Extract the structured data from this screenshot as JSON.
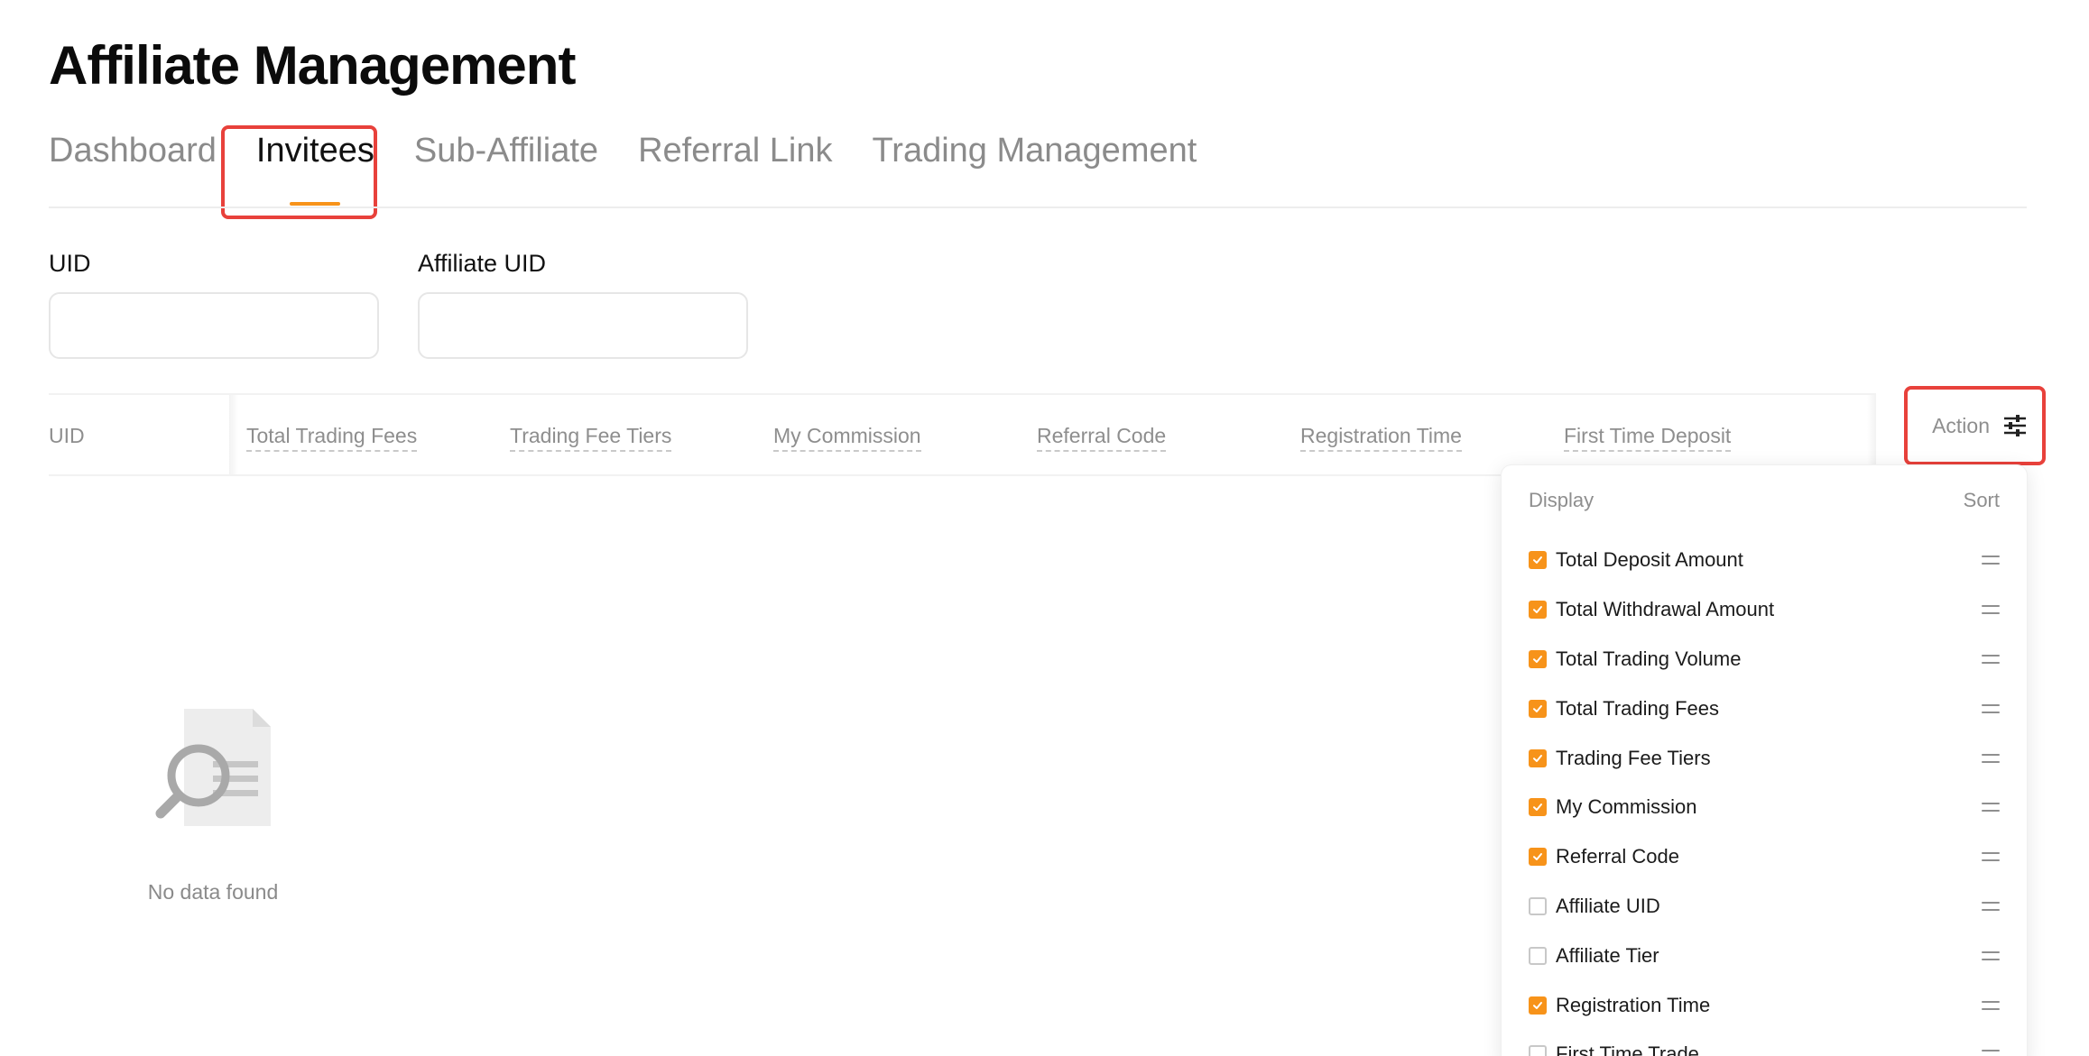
{
  "page": {
    "title": "Affiliate Management"
  },
  "tabs": [
    {
      "label": "Dashboard",
      "active": false
    },
    {
      "label": "Invitees",
      "active": true
    },
    {
      "label": "Sub-Affiliate",
      "active": false
    },
    {
      "label": "Referral Link",
      "active": false
    },
    {
      "label": "Trading Management",
      "active": false
    }
  ],
  "filters": {
    "uid": {
      "label": "UID",
      "value": ""
    },
    "affiliate_uid": {
      "label": "Affiliate UID",
      "value": ""
    }
  },
  "table": {
    "columns": [
      "UID",
      "Total Trading Fees",
      "Trading Fee Tiers",
      "My Commission",
      "Referral Code",
      "Registration Time",
      "First Time Deposit"
    ],
    "action_label": "Action",
    "action_icon": "sliders-icon",
    "empty_text": "No data found",
    "empty_icon": "document-search-icon"
  },
  "column_settings": {
    "display_label": "Display",
    "sort_label": "Sort",
    "items": [
      {
        "label": "Total Deposit Amount",
        "checked": true
      },
      {
        "label": "Total Withdrawal Amount",
        "checked": true
      },
      {
        "label": "Total Trading Volume",
        "checked": true
      },
      {
        "label": "Total Trading Fees",
        "checked": true
      },
      {
        "label": "Trading Fee Tiers",
        "checked": true
      },
      {
        "label": "My Commission",
        "checked": true
      },
      {
        "label": "Referral Code",
        "checked": true
      },
      {
        "label": "Affiliate UID",
        "checked": false
      },
      {
        "label": "Affiliate Tier",
        "checked": false
      },
      {
        "label": "Registration Time",
        "checked": true
      },
      {
        "label": "First Time Trade",
        "checked": false
      }
    ]
  },
  "colors": {
    "accent": "#f7931a",
    "highlight_border": "#e8413b"
  }
}
